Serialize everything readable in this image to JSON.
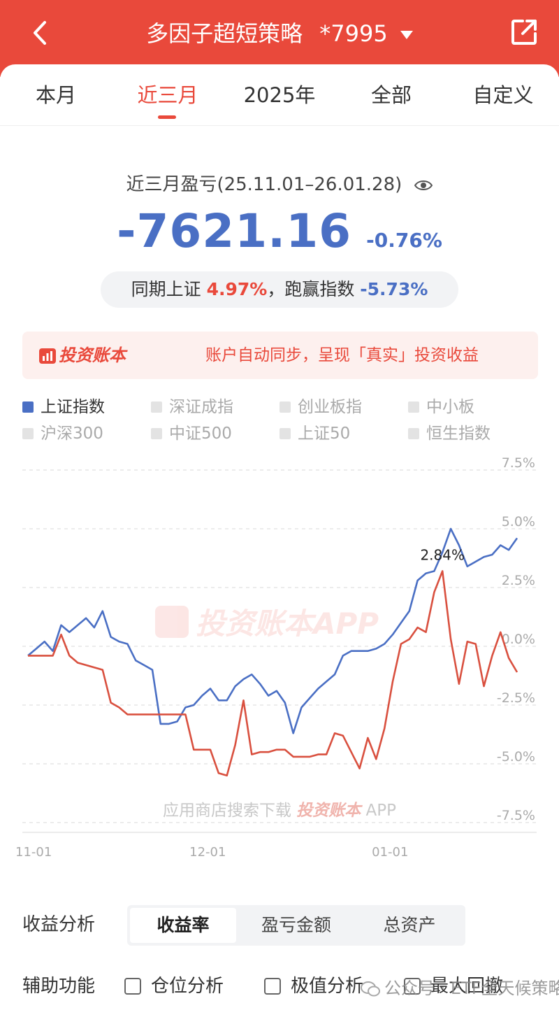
{
  "header": {
    "title": "多因子超短策略",
    "account": "*7995"
  },
  "tabs": [
    {
      "label": "本月"
    },
    {
      "label": "近三月"
    },
    {
      "label": "2025年"
    },
    {
      "label": "全部"
    },
    {
      "label": "自定义"
    }
  ],
  "summary": {
    "label": "近三月盈亏(25.11.01–26.01.28)",
    "amount": "-7621.16",
    "pct": "-0.76%",
    "compare_prefix": "同期上证",
    "compare_index": "4.97%",
    "compare_mid": "，跑赢指数",
    "compare_beat": "-5.73%"
  },
  "banner": {
    "logo": "投资账本",
    "text": "账户自动同步，呈现「真实」投资收益"
  },
  "legend": [
    {
      "label": "上证指数",
      "active": true
    },
    {
      "label": "深证成指",
      "active": false
    },
    {
      "label": "创业板指",
      "active": false
    },
    {
      "label": "中小板",
      "active": false
    },
    {
      "label": "沪深300",
      "active": false
    },
    {
      "label": "中证500",
      "active": false
    },
    {
      "label": "上证50",
      "active": false
    },
    {
      "label": "恒生指数",
      "active": false
    }
  ],
  "colors": {
    "brand": "#e9493b",
    "index_line": "#4a6fc4",
    "strategy_line": "#d9503f"
  },
  "chart_data": {
    "type": "line",
    "yticks": [
      "7.5%",
      "5.0%",
      "2.5%",
      "0.0%",
      "-2.5%",
      "-5.0%",
      "-7.5%"
    ],
    "ylim": [
      -7.5,
      7.5
    ],
    "xticks": [
      {
        "label": "11-01",
        "pos": 0
      },
      {
        "label": "12-01",
        "pos": 21
      },
      {
        "label": "01-01",
        "pos": 43
      }
    ],
    "x_count": 60,
    "annotation": "2.84%",
    "watermark_center": "投资账本APP",
    "watermark_bottom_prefix": "应用商店搜索下载",
    "watermark_bottom_logo": "投资账本",
    "watermark_bottom_suffix": "APP",
    "series": [
      {
        "values": [
          -0.4,
          -0.1,
          0.2,
          -0.2,
          0.9,
          0.6,
          0.9,
          1.2,
          0.8,
          1.5,
          0.4,
          0.2,
          0.1,
          -0.6,
          -0.8,
          -1.0,
          -3.3,
          -3.3,
          -3.2,
          -2.6,
          -2.5,
          -2.1,
          -1.8,
          -2.3,
          -2.3,
          -1.7,
          -1.4,
          -1.2,
          -1.6,
          -2.1,
          -1.9,
          -2.4,
          -3.7,
          -2.6,
          -2.2,
          -1.8,
          -1.5,
          -1.2,
          -0.4,
          -0.2,
          -0.2,
          -0.2,
          -0.1,
          0.1,
          0.5,
          1.0,
          1.5,
          2.8,
          3.1,
          3.2,
          4.0,
          5.0,
          4.3,
          3.4,
          3.6,
          3.8,
          3.9,
          4.3,
          4.1,
          4.6
        ]
      },
      {
        "values": [
          -0.4,
          -0.4,
          -0.4,
          -0.4,
          0.5,
          -0.4,
          -0.7,
          -0.8,
          -0.9,
          -1.0,
          -2.4,
          -2.6,
          -2.9,
          -2.9,
          -2.9,
          -2.9,
          -2.9,
          -2.9,
          -2.9,
          -2.9,
          -4.4,
          -4.4,
          -4.4,
          -5.4,
          -5.5,
          -4.2,
          -2.3,
          -4.6,
          -4.5,
          -4.5,
          -4.4,
          -4.4,
          -4.7,
          -4.7,
          -4.7,
          -4.6,
          -4.6,
          -3.7,
          -3.8,
          -4.5,
          -5.2,
          -3.9,
          -4.8,
          -3.5,
          -1.5,
          0.1,
          0.3,
          0.8,
          0.6,
          2.3,
          3.2,
          0.3,
          -1.6,
          0.2,
          0.1,
          -1.7,
          -0.4,
          0.6,
          -0.5,
          -1.1
        ]
      }
    ]
  },
  "analysis": {
    "label": "收益分析",
    "options": [
      {
        "label": "收益率",
        "active": true
      },
      {
        "label": "盈亏金额",
        "active": false
      },
      {
        "label": "总资产",
        "active": false
      }
    ]
  },
  "aux": {
    "label": "辅助功能",
    "options": [
      {
        "label": "仓位分析"
      },
      {
        "label": "极值分析"
      },
      {
        "label": "最大回撤"
      }
    ]
  },
  "footer_watermark": "公众号 · ETF全天候策略"
}
